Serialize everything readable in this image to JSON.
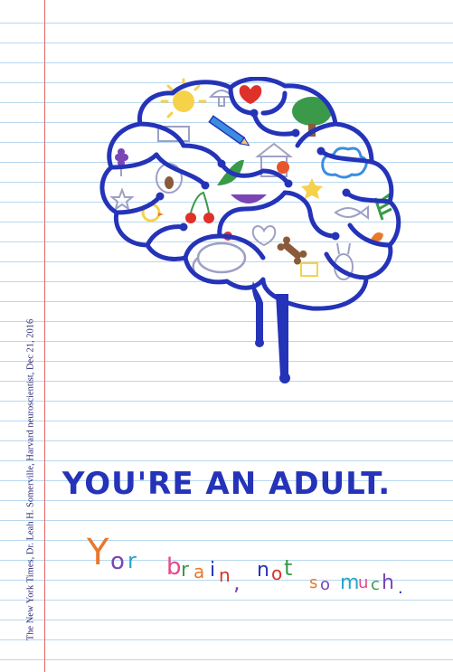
{
  "citation": "The New York Times, Dr. Leah H. Somerville, Harvard neuroscientist, Dec 21, 2016",
  "headline": "YOU'RE AN ADULT.",
  "tagline": {
    "text": "Yor brain, not so much.",
    "letters": [
      {
        "char": "Y",
        "color": "#e8782a"
      },
      {
        "char": "o",
        "color": "#7a45b5"
      },
      {
        "char": "r",
        "color": "#2aa5c9"
      },
      {
        "char": "b",
        "color": "#e54a8a"
      },
      {
        "char": "r",
        "color": "#3a9a4a"
      },
      {
        "char": "a",
        "color": "#e8782a"
      },
      {
        "char": "i",
        "color": "#2433b8"
      },
      {
        "char": "n",
        "color": "#d8332a"
      },
      {
        "char": ",",
        "color": "#7a45b5"
      },
      {
        "char": "n",
        "color": "#2433b8"
      },
      {
        "char": "o",
        "color": "#d8332a"
      },
      {
        "char": "t",
        "color": "#3a9a4a"
      },
      {
        "char": "s",
        "color": "#e8782a"
      },
      {
        "char": "o",
        "color": "#7a45b5"
      },
      {
        "char": "m",
        "color": "#2aa5c9"
      },
      {
        "char": "u",
        "color": "#e54a8a"
      },
      {
        "char": "c",
        "color": "#3a9a4a"
      },
      {
        "char": "h",
        "color": "#7a45b5"
      },
      {
        "char": ".",
        "color": "#2433b8"
      }
    ]
  },
  "colors": {
    "brain_outline": "#2433b8",
    "headline": "#2433b8",
    "margin_line": "#e06a6a",
    "ruled_line": "#b9d8ef",
    "doodle_gray": "#9ea0c4"
  },
  "doodle_icons": [
    "sun-icon",
    "heart-icon",
    "tree-icon",
    "cloud-icon",
    "bird-icon",
    "dog-icon",
    "house-icon",
    "flower-icon",
    "star-icon",
    "cherry-icon",
    "bone-icon",
    "mushroom-icon",
    "pencil-icon",
    "leaf-icon",
    "rabbit-icon",
    "elephant-icon",
    "apple-icon",
    "fish-icon"
  ]
}
